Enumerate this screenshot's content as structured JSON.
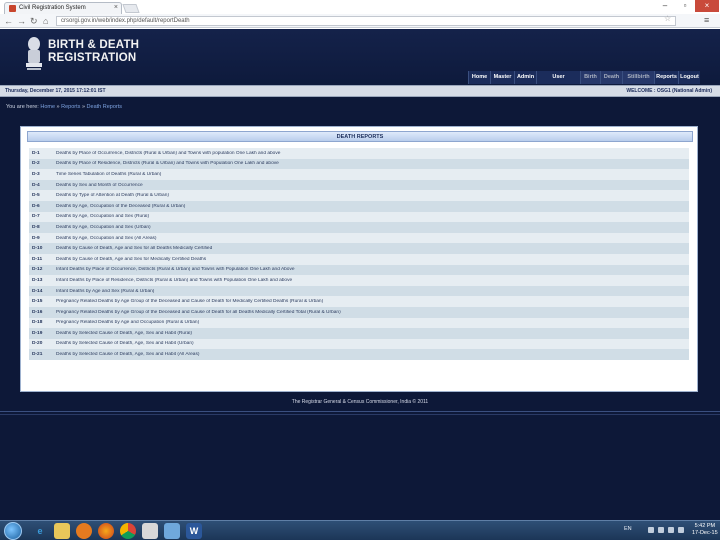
{
  "browser": {
    "tab_title": "Civil Registration System",
    "url": "crsorgi.gov.in/web/index.php/default/reportDeath"
  },
  "site": {
    "title_line1": "BIRTH & DEATH",
    "title_line2": "REGISTRATION",
    "nav": [
      {
        "label": "Home",
        "dim": false
      },
      {
        "label": "Master",
        "dim": false
      },
      {
        "label": "Admin",
        "dim": false
      },
      {
        "label": "User Management",
        "dim": false
      },
      {
        "label": "Birth",
        "dim": true
      },
      {
        "label": "Death",
        "dim": true
      },
      {
        "label": "Stillbirth",
        "dim": true
      },
      {
        "label": "Reports",
        "dim": false
      },
      {
        "label": "Logout",
        "dim": false
      }
    ],
    "date_text": "Thursday, December 17, 2015 17:12:01 IST",
    "welcome_text": "WELCOME : OSG1 (National Admin)",
    "breadcrumb_prefix": "You are here:",
    "breadcrumb_home": "Home",
    "breadcrumb_reports": "Reports",
    "breadcrumb_current": "Death Reports",
    "panel_title": "DEATH REPORTS",
    "footer": "The Registrar General & Census Commissioner, India © 2011"
  },
  "reports": [
    {
      "code": "D-1",
      "name": "Deaths by Place of Occurrence, Districts (Rural & Urban) and Towns with population One Lakh and above"
    },
    {
      "code": "D-2",
      "name": "Deaths by Place of Residence, Districts (Rural & Urban) and Towns with Population One Lakh and above"
    },
    {
      "code": "D-3",
      "name": "Time Series Tabulation of Deaths (Rural & Urban)"
    },
    {
      "code": "D-4",
      "name": "Deaths by Sex and Month of Occurrence"
    },
    {
      "code": "D-5",
      "name": "Deaths by Type of Attention at Death (Rural & Urban)"
    },
    {
      "code": "D-6",
      "name": "Deaths by Age, Occupation of the Deceased (Rural & Urban)"
    },
    {
      "code": "D-7",
      "name": "Deaths by Age, Occupation and Sex (Rural)"
    },
    {
      "code": "D-8",
      "name": "Deaths by Age, Occupation and Sex (Urban)"
    },
    {
      "code": "D-9",
      "name": "Deaths by Age, Occupation and Sex (All Areas)"
    },
    {
      "code": "D-10",
      "name": "Deaths by Cause of Death, Age and Sex for all Deaths Medically Certified"
    },
    {
      "code": "D-11",
      "name": "Deaths by Cause of Death, Age and Sex for Medically Certified Deaths"
    },
    {
      "code": "D-12",
      "name": "Infant Deaths by Place of Occurrence, Districts (Rural & Urban) and Towns with Population One Lakh and Above"
    },
    {
      "code": "D-13",
      "name": "Infant Deaths by Place of Residence, Districts (Rural & Urban) and Towns with Population One Lakh and above"
    },
    {
      "code": "D-14",
      "name": "Infant Deaths by Age and Sex (Rural & Urban)"
    },
    {
      "code": "D-15",
      "name": "Pregnancy Related Deaths by Age Group of the Deceased and Cause of Death for Medically Certified Deaths (Rural & Urban)"
    },
    {
      "code": "D-16",
      "name": "Pregnancy Related Deaths by Age Group of the Deceased and Cause of Death for all Deaths Medically Certified Total (Rural & Urban)"
    },
    {
      "code": "D-18",
      "name": "Pregnancy Related Deaths by Age and Occupation (Rural & Urban)"
    },
    {
      "code": "D-19",
      "name": "Deaths by Selected Cause of Death, Age, Sex and Habit (Rural)"
    },
    {
      "code": "D-20",
      "name": "Deaths by Selected Cause of Death, Age, Sex and Habit (Urban)"
    },
    {
      "code": "D-21",
      "name": "Deaths by Selected Cause of Death, Age, Sex and Habit (All Areas)"
    }
  ],
  "taskbar": {
    "language": "EN",
    "time": "5:42 PM",
    "date": "17-Dec-15",
    "icons": [
      "start-orb",
      "internet-explorer-icon",
      "file-explorer-icon",
      "media-player-icon",
      "firefox-icon",
      "chrome-icon",
      "files-icon",
      "image-viewer-icon",
      "word-icon"
    ]
  },
  "colors": {
    "site_background": "#0d1838",
    "panel_header": "#b9cdec",
    "row_odd": "#e6edf2",
    "row_even": "#d0dde6"
  }
}
